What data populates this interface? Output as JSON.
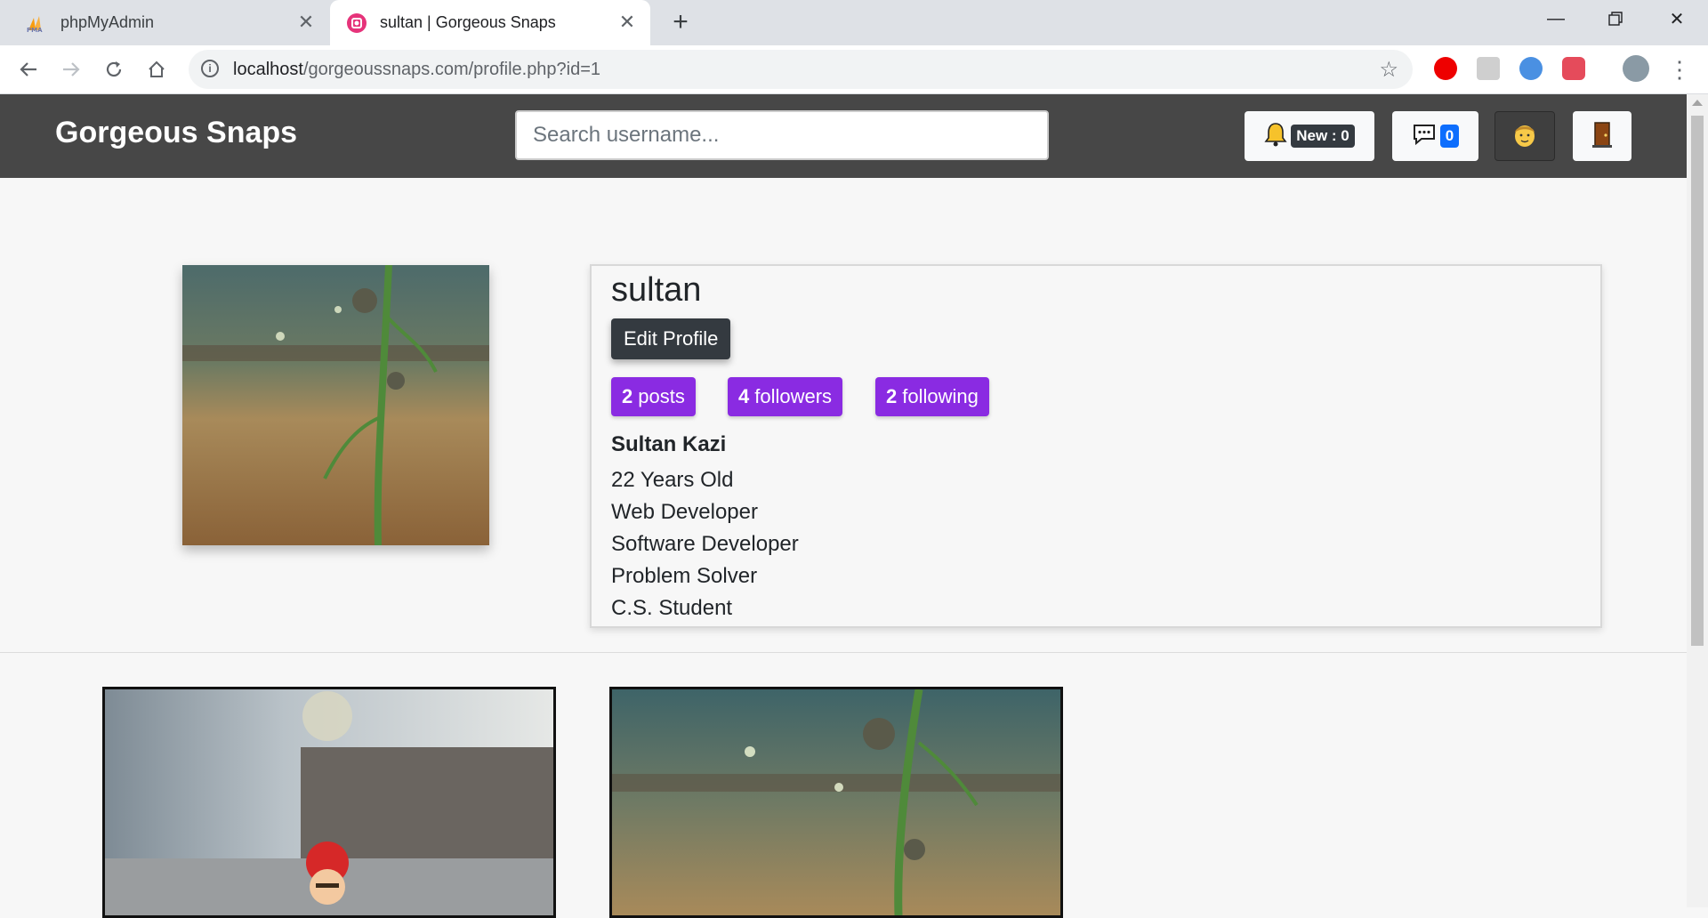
{
  "browser": {
    "tabs": [
      {
        "title": "phpMyAdmin",
        "active": false
      },
      {
        "title": "sultan | Gorgeous Snaps",
        "active": true
      }
    ],
    "url_host": "localhost",
    "url_path": "/gorgeoussnaps.com/profile.php?id=1",
    "new_tab_symbol": "+"
  },
  "header": {
    "brand": "Gorgeous Snaps",
    "search_placeholder": "Search username...",
    "notifications_label": "New : 0",
    "messages_count": "0",
    "profile_icon": "face-icon",
    "logout_icon": "door-icon"
  },
  "profile": {
    "username": "sultan",
    "edit_label": "Edit Profile",
    "stats": [
      {
        "count": "2",
        "label": "posts"
      },
      {
        "count": "4",
        "label": "followers"
      },
      {
        "count": "2",
        "label": "following"
      }
    ],
    "full_name": "Sultan Kazi",
    "bio": [
      "22 Years Old",
      "Web Developer",
      "Software Developer",
      "Problem Solver",
      "C.S. Student"
    ]
  },
  "colors": {
    "header_bg": "#474747",
    "stat_purple": "#8a2be2",
    "dark_button": "#343a40",
    "badge_blue": "#0d6efd"
  }
}
